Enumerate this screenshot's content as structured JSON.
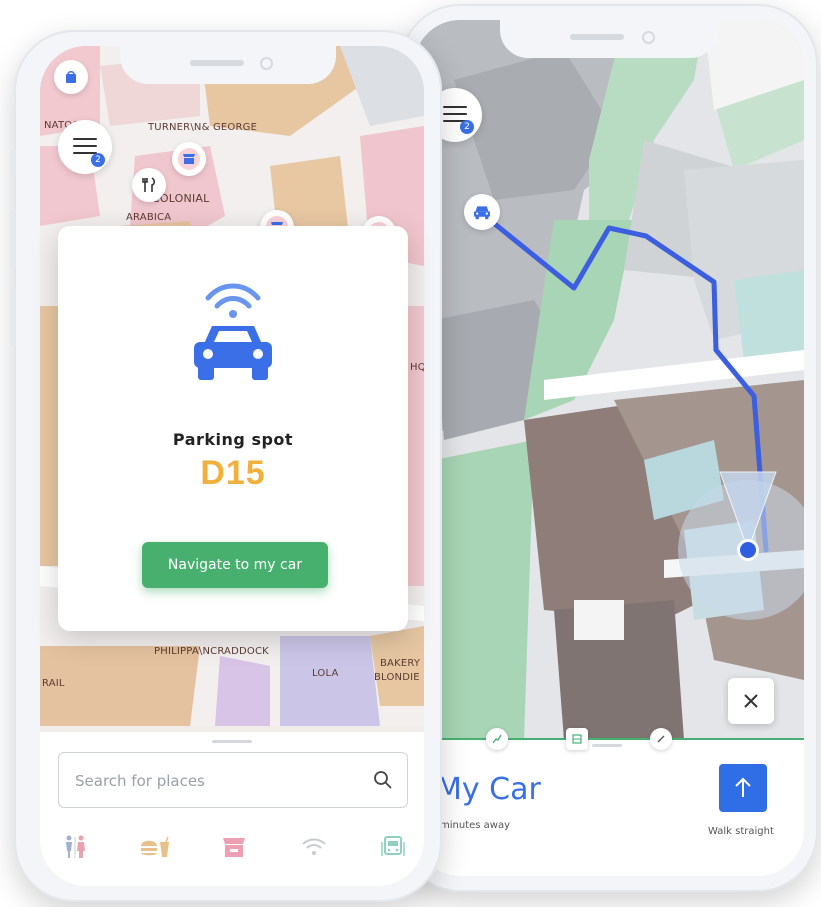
{
  "left_phone": {
    "menu_badge": "2",
    "map_labels": {
      "natoora": "NATOORA",
      "turner": "TURNER\\N& GEORGE",
      "colonial": "COLONIAL",
      "arabica": "ARABICA",
      "hq": "HQ",
      "rail": "RAIL",
      "philippa": "PHILIPPA\\NCRADDOCK",
      "lola": "LOLA",
      "bakery": "BAKERY",
      "blondie": "BLONDIE"
    },
    "card": {
      "label": "Parking spot",
      "spot": "D15",
      "button": "Navigate to my car"
    },
    "search": {
      "placeholder": "Search for places"
    },
    "categories": [
      {
        "icon": "restroom-icon"
      },
      {
        "icon": "food-drink-icon"
      },
      {
        "icon": "shop-icon"
      },
      {
        "icon": "wifi-icon"
      },
      {
        "icon": "transit-icon"
      }
    ]
  },
  "right_phone": {
    "menu_badge": "2",
    "destination": "My Car",
    "eta": "minutes away",
    "direction_label": "Walk straight"
  },
  "colors": {
    "accent_blue": "#3a6fe8",
    "spot_yellow": "#f0b03c",
    "nav_green": "#47b06f",
    "route_blue": "#3b5fe0"
  }
}
